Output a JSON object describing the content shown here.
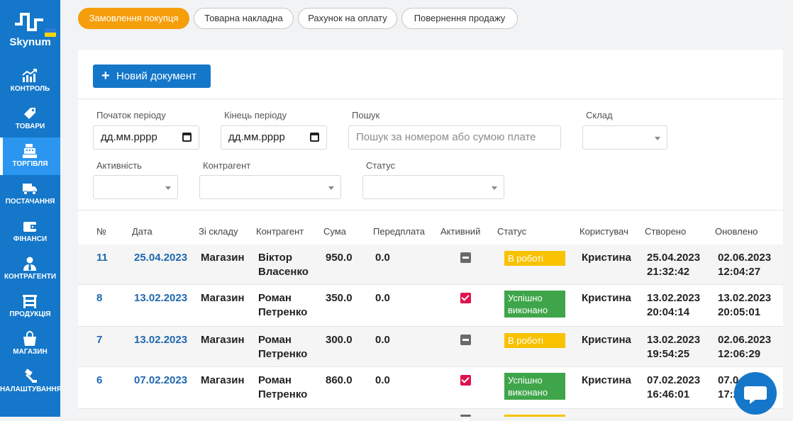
{
  "brand": {
    "name": "Skynum"
  },
  "sidebar": {
    "items": [
      {
        "label": "Контроль",
        "icon": "chart-up-icon"
      },
      {
        "label": "Товари",
        "icon": "tag-icon"
      },
      {
        "label": "Торгівля",
        "icon": "cash-register-icon"
      },
      {
        "label": "Постачання",
        "icon": "truck-icon"
      },
      {
        "label": "Фінанси",
        "icon": "wallet-icon"
      },
      {
        "label": "Контрагенти",
        "icon": "user-tie-icon"
      },
      {
        "label": "Продукція",
        "icon": "factory-icon"
      },
      {
        "label": "Магазин",
        "icon": "shopping-bag-icon"
      },
      {
        "label": "Налаштування",
        "icon": "hammer-icon"
      }
    ]
  },
  "tabs": [
    {
      "label": "Замовлення покупця",
      "active": true
    },
    {
      "label": "Товарна накладна",
      "active": false
    },
    {
      "label": "Рахунок на оплату",
      "active": false
    },
    {
      "label": "Повернення продажу",
      "active": false
    }
  ],
  "toolbar": {
    "new_document_label": "Новий документ"
  },
  "filters": {
    "period_start_label": "Початок періоду",
    "period_start_value": "дд.мм.рррр",
    "period_end_label": "Кінець періоду",
    "period_end_value": "дд.мм.рррр",
    "search_label": "Пошук",
    "search_placeholder": "Пошук за номером або сумою плате",
    "warehouse_label": "Склад",
    "activity_label": "Активність",
    "counterparty_label": "Контрагент",
    "status_label": "Статус"
  },
  "table": {
    "headers": [
      "№",
      "Дата",
      "Зі складу",
      "Контрагент",
      "Сума",
      "Передплата",
      "Активний",
      "Статус",
      "Користувач",
      "Створено",
      "Оновлено"
    ],
    "rows": [
      {
        "num": "11",
        "date": "25.04.2023",
        "warehouse": "Магазин",
        "counterparty_1": "Віктор",
        "counterparty_2": "Власенко",
        "sum": "950.0",
        "prepay": "0.0",
        "active": false,
        "status_1": "В роботі",
        "status_2": "",
        "status_color": "#f8c200",
        "user": "Кристина",
        "created_1": "25.04.2023",
        "created_2": "21:32:42",
        "updated_1": "02.06.2023",
        "updated_2": "12:04:27"
      },
      {
        "num": "8",
        "date": "13.02.2023",
        "warehouse": "Магазин",
        "counterparty_1": "Роман",
        "counterparty_2": "Петренко",
        "sum": "350.0",
        "prepay": "0.0",
        "active": true,
        "status_1": "Успішно",
        "status_2": "виконано",
        "status_color": "#3fa54a",
        "user": "Кристина",
        "created_1": "13.02.2023",
        "created_2": "20:04:14",
        "updated_1": "13.02.2023",
        "updated_2": "20:05:01"
      },
      {
        "num": "7",
        "date": "13.02.2023",
        "warehouse": "Магазин",
        "counterparty_1": "Роман",
        "counterparty_2": "Петренко",
        "sum": "300.0",
        "prepay": "0.0",
        "active": false,
        "status_1": "В роботі",
        "status_2": "",
        "status_color": "#f8c200",
        "user": "Кристина",
        "created_1": "13.02.2023",
        "created_2": "19:54:25",
        "updated_1": "02.06.2023",
        "updated_2": "12:06:29"
      },
      {
        "num": "6",
        "date": "07.02.2023",
        "warehouse": "Магазин",
        "counterparty_1": "Роман",
        "counterparty_2": "Петренко",
        "sum": "860.0",
        "prepay": "0.0",
        "active": true,
        "status_1": "Успішно",
        "status_2": "виконано",
        "status_color": "#3fa54a",
        "user": "Кристина",
        "created_1": "07.02.2023",
        "created_2": "16:46:01",
        "updated_1": "07.0",
        "updated_2": "17:2"
      }
    ]
  },
  "chat": {
    "icon": "chat-bubble-icon"
  }
}
